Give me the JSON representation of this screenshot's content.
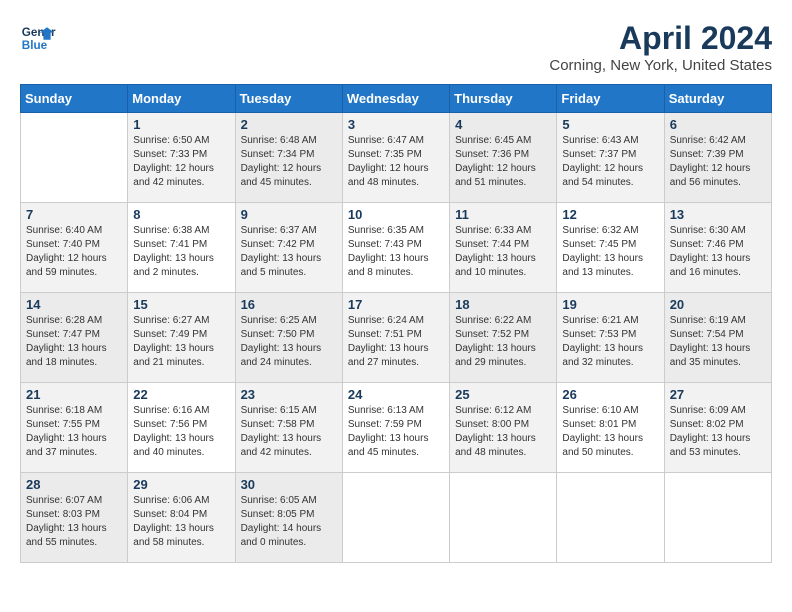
{
  "header": {
    "logo_general": "General",
    "logo_blue": "Blue",
    "title": "April 2024",
    "subtitle": "Corning, New York, United States"
  },
  "days_of_week": [
    "Sunday",
    "Monday",
    "Tuesday",
    "Wednesday",
    "Thursday",
    "Friday",
    "Saturday"
  ],
  "weeks": [
    [
      {
        "num": "",
        "info": ""
      },
      {
        "num": "1",
        "info": "Sunrise: 6:50 AM\nSunset: 7:33 PM\nDaylight: 12 hours\nand 42 minutes."
      },
      {
        "num": "2",
        "info": "Sunrise: 6:48 AM\nSunset: 7:34 PM\nDaylight: 12 hours\nand 45 minutes."
      },
      {
        "num": "3",
        "info": "Sunrise: 6:47 AM\nSunset: 7:35 PM\nDaylight: 12 hours\nand 48 minutes."
      },
      {
        "num": "4",
        "info": "Sunrise: 6:45 AM\nSunset: 7:36 PM\nDaylight: 12 hours\nand 51 minutes."
      },
      {
        "num": "5",
        "info": "Sunrise: 6:43 AM\nSunset: 7:37 PM\nDaylight: 12 hours\nand 54 minutes."
      },
      {
        "num": "6",
        "info": "Sunrise: 6:42 AM\nSunset: 7:39 PM\nDaylight: 12 hours\nand 56 minutes."
      }
    ],
    [
      {
        "num": "7",
        "info": "Sunrise: 6:40 AM\nSunset: 7:40 PM\nDaylight: 12 hours\nand 59 minutes."
      },
      {
        "num": "8",
        "info": "Sunrise: 6:38 AM\nSunset: 7:41 PM\nDaylight: 13 hours\nand 2 minutes."
      },
      {
        "num": "9",
        "info": "Sunrise: 6:37 AM\nSunset: 7:42 PM\nDaylight: 13 hours\nand 5 minutes."
      },
      {
        "num": "10",
        "info": "Sunrise: 6:35 AM\nSunset: 7:43 PM\nDaylight: 13 hours\nand 8 minutes."
      },
      {
        "num": "11",
        "info": "Sunrise: 6:33 AM\nSunset: 7:44 PM\nDaylight: 13 hours\nand 10 minutes."
      },
      {
        "num": "12",
        "info": "Sunrise: 6:32 AM\nSunset: 7:45 PM\nDaylight: 13 hours\nand 13 minutes."
      },
      {
        "num": "13",
        "info": "Sunrise: 6:30 AM\nSunset: 7:46 PM\nDaylight: 13 hours\nand 16 minutes."
      }
    ],
    [
      {
        "num": "14",
        "info": "Sunrise: 6:28 AM\nSunset: 7:47 PM\nDaylight: 13 hours\nand 18 minutes."
      },
      {
        "num": "15",
        "info": "Sunrise: 6:27 AM\nSunset: 7:49 PM\nDaylight: 13 hours\nand 21 minutes."
      },
      {
        "num": "16",
        "info": "Sunrise: 6:25 AM\nSunset: 7:50 PM\nDaylight: 13 hours\nand 24 minutes."
      },
      {
        "num": "17",
        "info": "Sunrise: 6:24 AM\nSunset: 7:51 PM\nDaylight: 13 hours\nand 27 minutes."
      },
      {
        "num": "18",
        "info": "Sunrise: 6:22 AM\nSunset: 7:52 PM\nDaylight: 13 hours\nand 29 minutes."
      },
      {
        "num": "19",
        "info": "Sunrise: 6:21 AM\nSunset: 7:53 PM\nDaylight: 13 hours\nand 32 minutes."
      },
      {
        "num": "20",
        "info": "Sunrise: 6:19 AM\nSunset: 7:54 PM\nDaylight: 13 hours\nand 35 minutes."
      }
    ],
    [
      {
        "num": "21",
        "info": "Sunrise: 6:18 AM\nSunset: 7:55 PM\nDaylight: 13 hours\nand 37 minutes."
      },
      {
        "num": "22",
        "info": "Sunrise: 6:16 AM\nSunset: 7:56 PM\nDaylight: 13 hours\nand 40 minutes."
      },
      {
        "num": "23",
        "info": "Sunrise: 6:15 AM\nSunset: 7:58 PM\nDaylight: 13 hours\nand 42 minutes."
      },
      {
        "num": "24",
        "info": "Sunrise: 6:13 AM\nSunset: 7:59 PM\nDaylight: 13 hours\nand 45 minutes."
      },
      {
        "num": "25",
        "info": "Sunrise: 6:12 AM\nSunset: 8:00 PM\nDaylight: 13 hours\nand 48 minutes."
      },
      {
        "num": "26",
        "info": "Sunrise: 6:10 AM\nSunset: 8:01 PM\nDaylight: 13 hours\nand 50 minutes."
      },
      {
        "num": "27",
        "info": "Sunrise: 6:09 AM\nSunset: 8:02 PM\nDaylight: 13 hours\nand 53 minutes."
      }
    ],
    [
      {
        "num": "28",
        "info": "Sunrise: 6:07 AM\nSunset: 8:03 PM\nDaylight: 13 hours\nand 55 minutes."
      },
      {
        "num": "29",
        "info": "Sunrise: 6:06 AM\nSunset: 8:04 PM\nDaylight: 13 hours\nand 58 minutes."
      },
      {
        "num": "30",
        "info": "Sunrise: 6:05 AM\nSunset: 8:05 PM\nDaylight: 14 hours\nand 0 minutes."
      },
      {
        "num": "",
        "info": ""
      },
      {
        "num": "",
        "info": ""
      },
      {
        "num": "",
        "info": ""
      },
      {
        "num": "",
        "info": ""
      }
    ]
  ]
}
